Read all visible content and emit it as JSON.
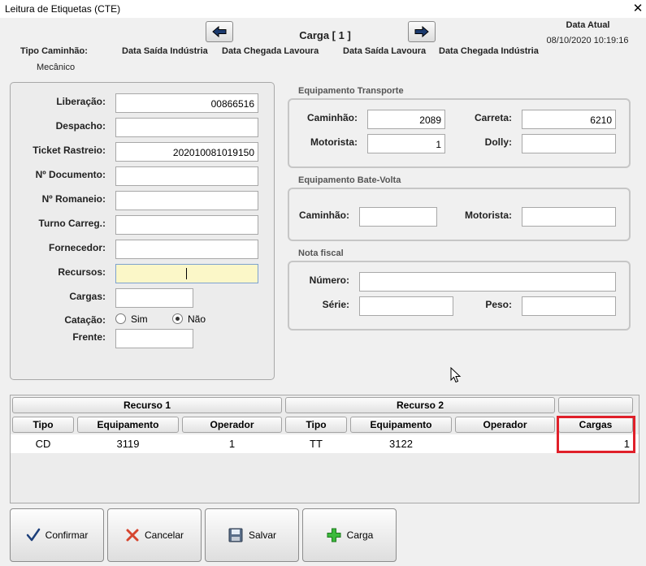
{
  "window": {
    "title": "Leitura de Etiquetas (CTE)",
    "close_glyph": "✕"
  },
  "header": {
    "carga_title": "Carga [ 1 ]",
    "data_atual_label": "Data Atual",
    "data_atual_value": "08/10/2020 10:19:16",
    "tipo_caminhao_label": "Tipo Caminhão:",
    "tipo_caminhao_value": "Mecânico",
    "col_saida_industria": "Data Saída Indústria",
    "col_chegada_lavoura": "Data Chegada Lavoura",
    "col_saida_lavoura": "Data Saída Lavoura",
    "col_chegada_industria": "Data Chegada Indústria",
    "prev_icon": "arrow-left-icon",
    "next_icon": "arrow-right-icon"
  },
  "left_form": {
    "liberacao": {
      "label": "Liberação:",
      "value": "00866516"
    },
    "despacho": {
      "label": "Despacho:",
      "value": ""
    },
    "ticket_rastreio": {
      "label": "Ticket Rastreio:",
      "value": "202010081019150"
    },
    "n_documento": {
      "label": "Nº Documento:",
      "value": ""
    },
    "n_romaneio": {
      "label": "Nº Romaneio:",
      "value": ""
    },
    "turno_carreg": {
      "label": "Turno Carreg.:",
      "value": ""
    },
    "fornecedor": {
      "label": "Fornecedor:",
      "value": ""
    },
    "recursos": {
      "label": "Recursos:",
      "value": ""
    },
    "cargas": {
      "label": "Cargas:",
      "value": ""
    },
    "catacao": {
      "label": "Catação:",
      "sim": "Sim",
      "nao": "Não",
      "selected": "Não"
    },
    "frente": {
      "label": "Frente:",
      "value": ""
    }
  },
  "equip_transporte": {
    "title": "Equipamento Transporte",
    "caminhao_label": "Caminhão:",
    "caminhao_value": "2089",
    "carreta_label": "Carreta:",
    "carreta_value": "6210",
    "motorista_label": "Motorista:",
    "motorista_value": "1",
    "dolly_label": "Dolly:",
    "dolly_value": ""
  },
  "equip_bate_volta": {
    "title": "Equipamento Bate-Volta",
    "caminhao_label": "Caminhão:",
    "caminhao_value": "",
    "motorista_label": "Motorista:",
    "motorista_value": ""
  },
  "nota_fiscal": {
    "title": "Nota fiscal",
    "numero_label": "Número:",
    "numero_value": "",
    "serie_label": "Série:",
    "serie_value": "",
    "peso_label": "Peso:",
    "peso_value": ""
  },
  "grid": {
    "group1": "Recurso 1",
    "group2": "Recurso 2",
    "group3": "",
    "columns": [
      "Tipo",
      "Equipamento",
      "Operador",
      "Tipo",
      "Equipamento",
      "Operador",
      "Cargas"
    ],
    "rows": [
      [
        "CD",
        "3119",
        "1",
        "TT",
        "3122",
        "",
        "1"
      ]
    ],
    "highlight_color": "#e0202a"
  },
  "buttons": {
    "confirmar": "Confirmar",
    "cancelar": "Cancelar",
    "salvar": "Salvar",
    "carga": "Carga"
  }
}
